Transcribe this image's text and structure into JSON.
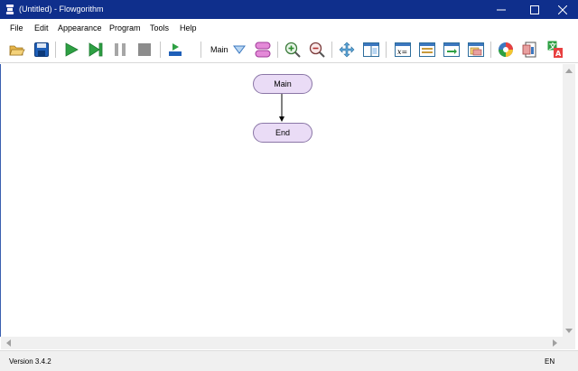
{
  "window": {
    "title": "(Untitled) - Flowgorithm",
    "app_icon": "flowgorithm-icon",
    "controls": [
      "minimize-icon",
      "maximize-icon",
      "close-icon"
    ]
  },
  "menu": {
    "items": [
      "File",
      "Edit",
      "Appearance",
      "Program",
      "Tools",
      "Help"
    ]
  },
  "toolbar": {
    "function_selector": "Main",
    "icons": [
      "open-folder-icon",
      "save-disk-icon",
      "run-icon",
      "step-icon",
      "pause-icon",
      "stop-icon",
      "speed-icon",
      "dropdown-arrow-icon",
      "function-dropdown-icon",
      "manage-functions-icon",
      "zoom-in-icon",
      "zoom-out-icon",
      "pan-icon",
      "layout-icon",
      "variable-watch-icon",
      "console-icon",
      "output-icon",
      "source-view-icon",
      "color-theme-icon",
      "export-icon",
      "translate-icon"
    ]
  },
  "flowchart": {
    "nodes": [
      {
        "id": "main",
        "label": "Main"
      },
      {
        "id": "end",
        "label": "End"
      }
    ],
    "edges": [
      {
        "from": "main",
        "to": "end"
      }
    ],
    "node_fill": "#eadcf6",
    "node_border": "#8a76a6"
  },
  "status": {
    "version": "Version 3.4.2",
    "language": "EN"
  },
  "colors": {
    "titlebar": "#0f2f8c",
    "run_green": "#2ea043",
    "stop_gray": "#8c8c8c"
  }
}
